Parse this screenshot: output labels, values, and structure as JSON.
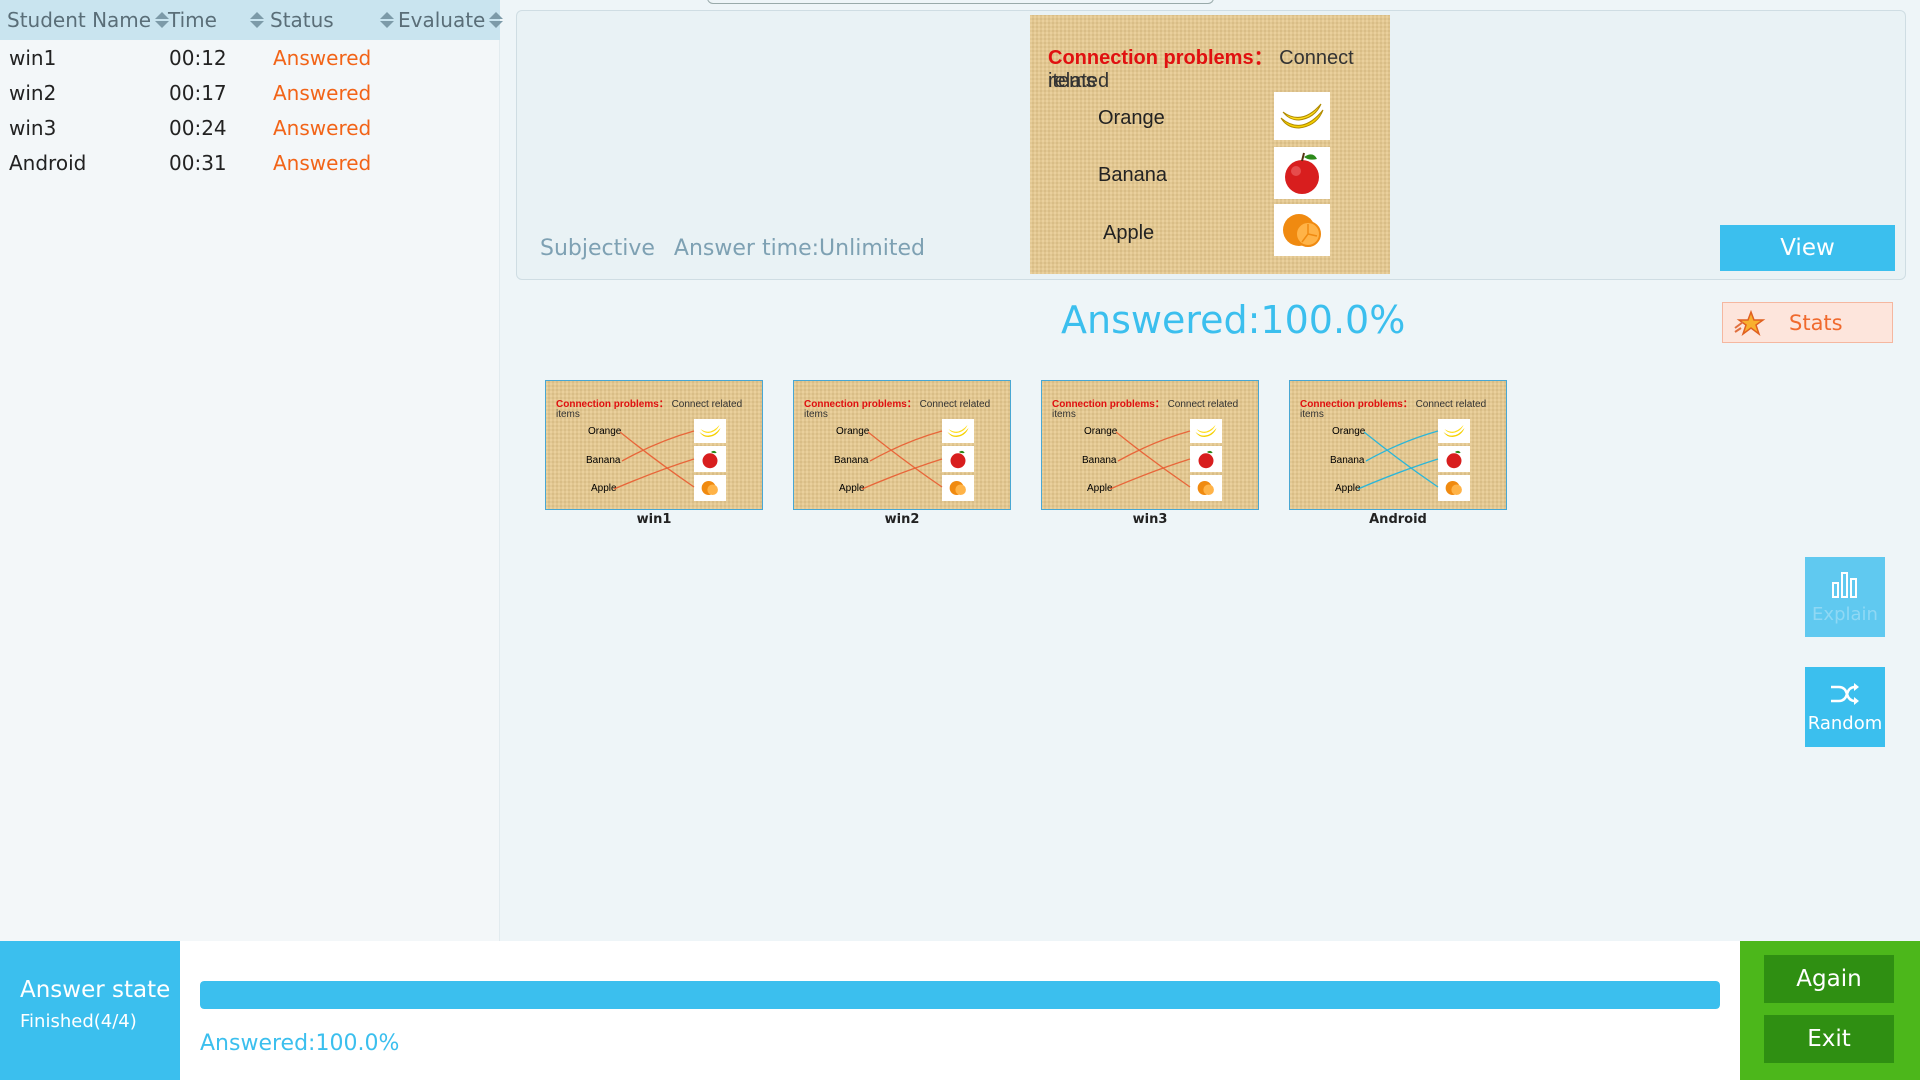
{
  "table": {
    "headers": [
      "Student Name",
      "Time",
      "Status",
      "Evaluate"
    ],
    "rows": [
      {
        "name": "win1",
        "time": "00:12",
        "status": "Answered"
      },
      {
        "name": "win2",
        "time": "00:17",
        "status": "Answered"
      },
      {
        "name": "win3",
        "time": "00:24",
        "status": "Answered"
      },
      {
        "name": "Android",
        "time": "00:31",
        "status": "Answered"
      }
    ]
  },
  "question": {
    "title_red": "Connection problems：",
    "title_rest": "Connect related",
    "title_line2": "items",
    "items": [
      "Orange",
      "Banana",
      "Apple"
    ],
    "type": "Subjective",
    "answer_time": "Answer time:Unlimited",
    "view_label": "View"
  },
  "stats_label": "Stats",
  "answered_rate": "Answered:100.0%",
  "submissions": [
    {
      "name": "win1",
      "line_color": "#e8663a"
    },
    {
      "name": "win2",
      "line_color": "#e8663a"
    },
    {
      "name": "win3",
      "line_color": "#e8663a"
    },
    {
      "name": "Android",
      "line_color": "#2bb6d9"
    }
  ],
  "side_buttons": {
    "explain": "Explain",
    "random": "Random"
  },
  "bottom": {
    "state_title": "Answer state",
    "state_sub": "Finished(4/4)",
    "progress": 1.0,
    "progress_text": "Answered:100.0%",
    "again_label": "Again",
    "exit_label": "Exit"
  },
  "colors": {
    "accent": "#3bbfee",
    "answered": "#f26418",
    "green": "#4cb71b"
  }
}
